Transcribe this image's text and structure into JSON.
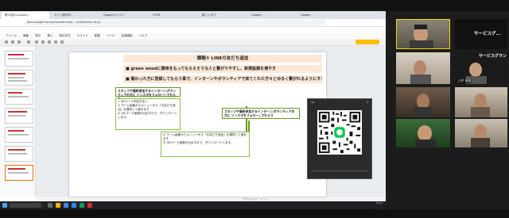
{
  "browser": {
    "tabs": [
      "第15回(14)Zoom...",
      "サイト制作中...",
      "Googleスライド",
      "HTML",
      "新しいタブ",
      "Google ...",
      "Google ..."
    ],
    "url": "docs.google.com/presentation/d/... /edit#slide=id.g1"
  },
  "menus": [
    "ファイル",
    "編集",
    "表示",
    "挿入",
    "表示形式",
    "スライド",
    "配置",
    "ツール",
    "拡張機能",
    "ヘルプ"
  ],
  "present_label": "スライドショー",
  "slide": {
    "title": "課題③ LINEの友だち追加",
    "bullet1": "■ green woodに興味をもってもらえそうな人と繋がりやすし、新規拡興を増やす",
    "bullet2": "■ 関わった方に登録してもらう事で、インターンやボランティアで来てくれた方々とゆるく繋がれるようにする",
    "flow_header": "スタッフや最終参加するインターン/ボランティアの方に インスタをフォローしてもらう",
    "flow_header_sub": "（インスタのQRコード作成）",
    "box1_title": "＜QRコード作成方法＞",
    "box1_line1": "① ホーム画面からメニューから「お友だち追加」を選択して進みます",
    "box1_line2": "② QRコード画像が出ますので、ダウンロードします。",
    "box2_line1": "① ホーム画面からメニューから「お友だち追加」を選択して進みます",
    "box2_line2": "② QRコード画像が出ますので、ダウンロードします。",
    "right_header": "スタッフや最終参加するインターン/ボランティアの方に インスタをフォローしてもらう",
    "right_header_sub": "（インスタのQRコード作成）"
  },
  "qr_window": {
    "title": "QR",
    "close": "×"
  },
  "statusbar_text": "スライドショー  ノート",
  "clock": {
    "time": "14:02",
    "date": "2022/12/08"
  },
  "participants": [
    {
      "name": "",
      "label": ""
    },
    {
      "name": "",
      "label": "サービスグ..."
    },
    {
      "name": "",
      "label": ""
    },
    {
      "name": "上村 淳司",
      "label": "サービスグラン"
    },
    {
      "name": "",
      "label": ""
    },
    {
      "name": "",
      "label": ""
    },
    {
      "name": "",
      "label": ""
    },
    {
      "name": "",
      "label": ""
    }
  ]
}
